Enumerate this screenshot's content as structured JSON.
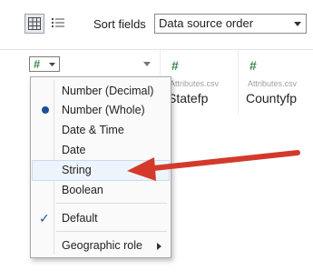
{
  "toolbar": {
    "sort_label": "Sort fields",
    "sort_value": "Data source order"
  },
  "columns": [
    {
      "type_icon": "#",
      "source": "",
      "name": ""
    },
    {
      "type_icon": "#",
      "source": "Attributes.csv",
      "name": "Statefp"
    },
    {
      "type_icon": "#",
      "source": "Attributes.csv",
      "name": "Countyfp"
    }
  ],
  "menu": {
    "items": [
      {
        "label": "Number (Decimal)"
      },
      {
        "label": "Number (Whole)",
        "selected": true
      },
      {
        "label": "Date & Time"
      },
      {
        "label": "Date"
      },
      {
        "label": "String",
        "hovered": true
      },
      {
        "label": "Boolean"
      },
      {
        "label": "Default",
        "checked": true
      },
      {
        "label": "Geographic role",
        "has_submenu": true
      }
    ]
  },
  "colors": {
    "accent": "#1d4e9a",
    "arrow": "#d33a2c",
    "type_icon": "#3a8a4a"
  }
}
